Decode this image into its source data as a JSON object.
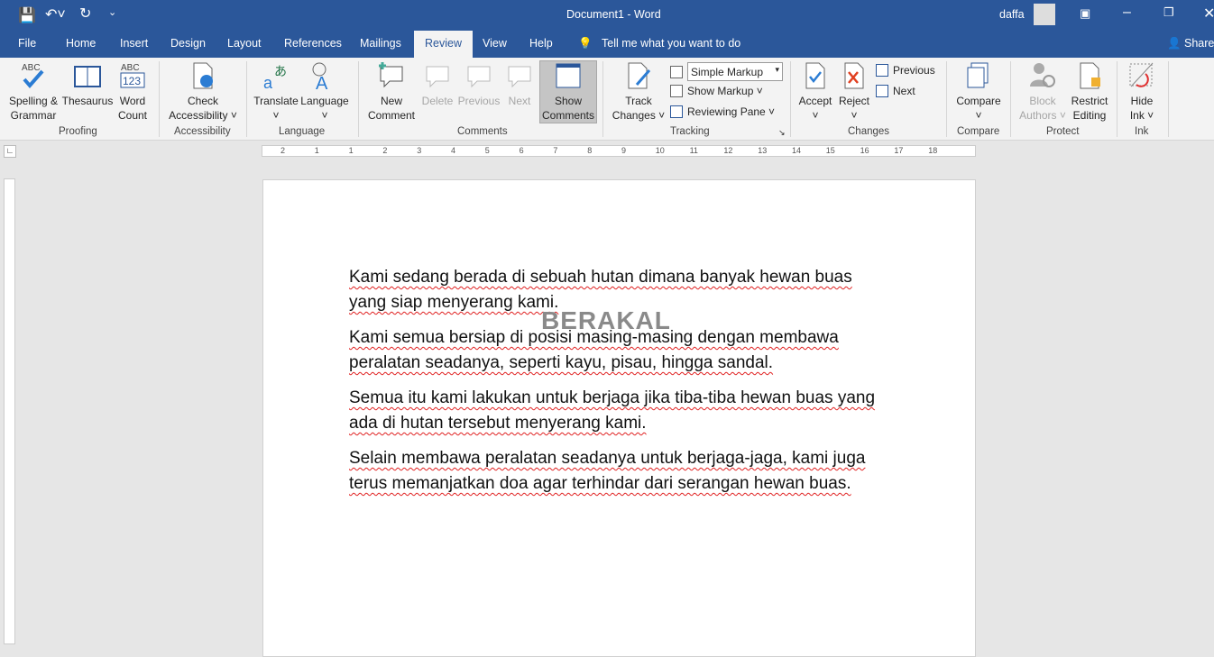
{
  "titlebar": {
    "title": "Document1  -  Word",
    "user": "daffa"
  },
  "tabs": [
    "File",
    "Home",
    "Insert",
    "Design",
    "Layout",
    "References",
    "Mailings",
    "Review",
    "View",
    "Help"
  ],
  "tell_me": "Tell me what you want to do",
  "share": "Share",
  "ribbon": {
    "proofing": {
      "label": "Proofing",
      "spelling": "Spelling &",
      "spelling2": "Grammar",
      "thesaurus": "Thesaurus",
      "wordcount": "Word",
      "wordcount2": "Count"
    },
    "accessibility": {
      "label": "Accessibility",
      "check": "Check",
      "check2": "Accessibility ˅"
    },
    "language": {
      "label": "Language",
      "translate": "Translate",
      "language": "Language"
    },
    "comments": {
      "label": "Comments",
      "new": "New",
      "new2": "Comment",
      "delete": "Delete",
      "previous": "Previous",
      "next": "Next",
      "show": "Show",
      "show2": "Comments"
    },
    "tracking": {
      "label": "Tracking",
      "track": "Track",
      "track2": "Changes ˅",
      "markup_select": "Simple Markup",
      "show_markup": "Show Markup ˅",
      "reviewing_pane": "Reviewing Pane ˅"
    },
    "changes": {
      "label": "Changes",
      "accept": "Accept",
      "reject": "Reject",
      "previous": "Previous",
      "next": "Next"
    },
    "compare": {
      "label": "Compare",
      "compare": "Compare"
    },
    "protect": {
      "label": "Protect",
      "block": "Block",
      "block2": "Authors ˅",
      "restrict": "Restrict",
      "restrict2": "Editing"
    },
    "ink": {
      "label": "Ink",
      "hide": "Hide",
      "hide2": "Ink ˅"
    }
  },
  "ruler": [
    "2",
    "1",
    "1",
    "2",
    "3",
    "4",
    "5",
    "6",
    "7",
    "8",
    "9",
    "10",
    "11",
    "12",
    "13",
    "14",
    "15",
    "16",
    "17",
    "18"
  ],
  "document": {
    "watermark": "BERAKAL",
    "paragraphs": [
      [
        "Kami sedang berada di sebuah hutan dimana banyak hewan buas",
        "yang siap menyerang kami."
      ],
      [
        "Kami semua bersiap di posisi masing-masing dengan membawa",
        "peralatan seadanya, seperti kayu, pisau, hingga sandal."
      ],
      [
        "Semua itu kami lakukan untuk berjaga jika tiba-tiba hewan buas yang",
        "ada di hutan tersebut menyerang kami."
      ],
      [
        "Selain membawa peralatan seadanya untuk berjaga-jaga, kami juga",
        "terus memanjatkan doa agar terhindar dari serangan hewan buas."
      ]
    ]
  },
  "colors": {
    "brand": "#2b579a",
    "spell_error": "#e02020"
  }
}
